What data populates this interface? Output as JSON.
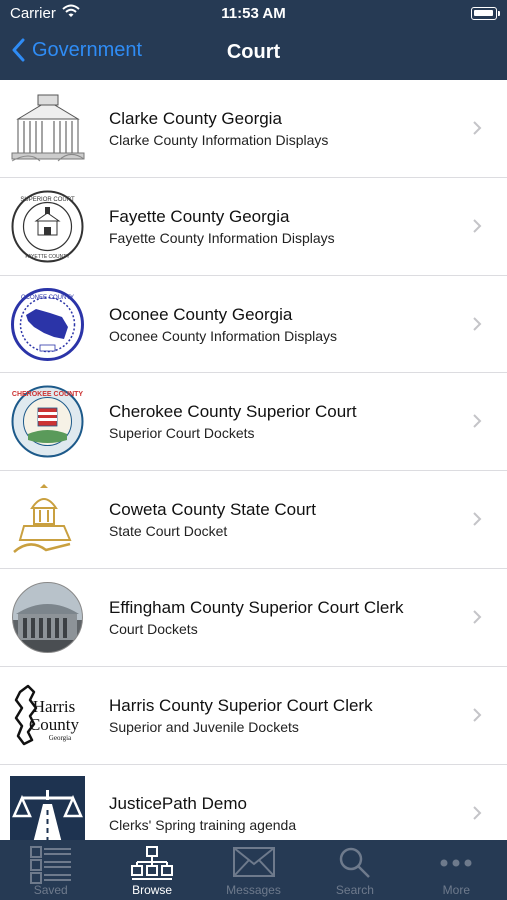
{
  "status_bar": {
    "carrier": "Carrier",
    "time": "11:53 AM"
  },
  "nav": {
    "back_label": "Government",
    "title": "Court"
  },
  "items": [
    {
      "title": "Clarke County Georgia",
      "subtitle": "Clarke County Information Displays",
      "logo": "courthouse-sketch-icon"
    },
    {
      "title": "Fayette County Georgia",
      "subtitle": "Fayette County Information Displays",
      "logo": "superior-court-seal-icon"
    },
    {
      "title": "Oconee County Georgia",
      "subtitle": "Oconee County Information Displays",
      "logo": "oconee-county-seal-icon"
    },
    {
      "title": "Cherokee County Superior Court",
      "subtitle": "Superior Court Dockets",
      "logo": "cherokee-county-seal-icon"
    },
    {
      "title": "Coweta County State Court",
      "subtitle": "State Court Docket",
      "logo": "courthouse-dome-icon"
    },
    {
      "title": "Effingham County Superior Court Clerk",
      "subtitle": "Court Dockets",
      "logo": "effingham-courthouse-photo-icon"
    },
    {
      "title": "Harris County Superior Court Clerk",
      "subtitle": "Superior and Juvenile Dockets",
      "logo": "harris-county-logo-icon"
    },
    {
      "title": "JusticePath Demo",
      "subtitle": "Clerks' Spring training agenda",
      "logo": "justicepath-scales-icon"
    }
  ],
  "tabs": [
    {
      "label": "Saved",
      "icon": "saved-list-icon",
      "active": false
    },
    {
      "label": "Browse",
      "icon": "browse-hierarchy-icon",
      "active": true
    },
    {
      "label": "Messages",
      "icon": "envelope-icon",
      "active": false
    },
    {
      "label": "Search",
      "icon": "magnifier-icon",
      "active": false
    },
    {
      "label": "More",
      "icon": "ellipsis-icon",
      "active": false
    }
  ],
  "colors": {
    "nav_background": "#263a54",
    "accent": "#2f8cf5",
    "tab_inactive": "#6e7a8c"
  }
}
